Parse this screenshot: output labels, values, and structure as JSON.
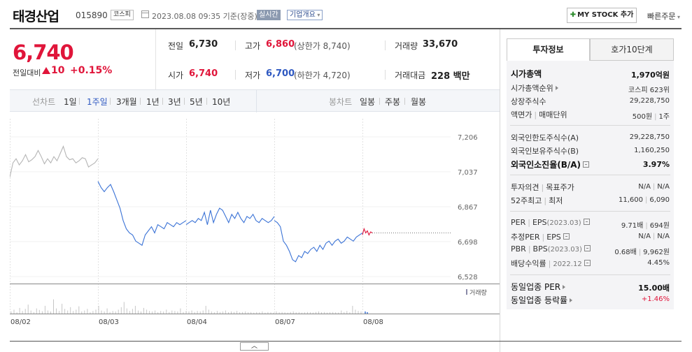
{
  "header": {
    "company_name": "태경산업",
    "stock_code": "015890",
    "market_badge": "코스피",
    "timestamp": "2023.08.08 09:35 기준(장중)",
    "realtime_badge": "실시간",
    "company_overview_label": "기업개요",
    "mystock_label": "MY STOCK 추가",
    "quick_order_label": "빠른주문"
  },
  "price": {
    "current": "6,740",
    "change_label": "전일대비",
    "change_value": "10",
    "change_pct": "+0.15%",
    "accent_color": "#e0153a"
  },
  "quote": {
    "prev_close_label": "전일",
    "prev_close": "6,730",
    "high_label": "고가",
    "high": "6,860",
    "upper_limit": "(상한가 8,740)",
    "volume_label": "거래량",
    "volume": "33,670",
    "open_label": "시가",
    "open": "6,740",
    "low_label": "저가",
    "low": "6,700",
    "lower_limit": "(하한가 4,720)",
    "amount_label": "거래대금",
    "amount": "228 백만"
  },
  "chart_toolbar": {
    "line_chart_label": "선차트",
    "line_periods": [
      "1일",
      "1주일",
      "3개월",
      "1년",
      "3년",
      "5년",
      "10년"
    ],
    "active_line_period": "1주일",
    "candle_chart_label": "봉차트",
    "candle_periods": [
      "일봉",
      "주봉",
      "월봉"
    ]
  },
  "right_panel": {
    "tabs": [
      "투자정보",
      "호가10단계"
    ],
    "market_cap_label": "시가총액",
    "market_cap": "1,970억원",
    "cap_rank_label": "시가총액순위",
    "cap_rank": "코스피 623위",
    "shares_label": "상장주식수",
    "shares": "29,228,750",
    "par_label": "액면가",
    "par_label2": "매매단위",
    "par": "500원",
    "unit": "1주",
    "foreign_limit_label": "외국인한도주식수(A)",
    "foreign_limit": "29,228,750",
    "foreign_hold_label": "외국인보유주식수(B)",
    "foreign_hold": "1,160,250",
    "foreign_ratio_label": "외국인소진율(B/A)",
    "foreign_ratio": "3.97%",
    "opinion_label": "투자의견",
    "target_label": "목표주가",
    "opinion": "N/A",
    "target": "N/A",
    "week52_label": "52주최고",
    "week52_low_label": "최저",
    "week52_high": "11,600",
    "week52_low": "6,090",
    "per_label": "PER",
    "eps_label": "EPS",
    "per_period": "(2023.03)",
    "per": "9.71배",
    "eps": "694원",
    "est_per_label": "추정PER",
    "est_eps_label": "EPS",
    "est_per": "N/A",
    "est_eps": "N/A",
    "pbr_label": "PBR",
    "bps_label": "BPS",
    "pbr_period": "(2023.03)",
    "pbr": "0.68배",
    "bps": "9,962원",
    "div_label": "배당수익률",
    "div_period": "2022.12",
    "div": "4.45%",
    "industry_per_label": "동일업종 PER",
    "industry_per": "15.00배",
    "industry_change_label": "동일업종 등락률",
    "industry_change": "+1.46%"
  },
  "chart_data": {
    "type": "line",
    "x": [
      "08/02",
      "08/03",
      "08/04",
      "08/07",
      "08/08"
    ],
    "y_ticks": [
      7206,
      7037,
      6867,
      6698,
      6528
    ],
    "ylim": [
      6528,
      7206
    ],
    "ylabel": "",
    "volume_label": "거래량",
    "series": [
      {
        "day": "08/02",
        "values": [
          7010,
          7080,
          7100,
          7070,
          7090,
          7120,
          7085,
          7095,
          7110,
          7140,
          7110,
          7075,
          7100,
          7080,
          7110,
          7090,
          7125,
          7160,
          7110,
          7095,
          7100,
          7080,
          7090,
          7105,
          7100,
          7060,
          7070,
          7080,
          7100
        ]
      },
      {
        "day": "08/03",
        "values": [
          6990,
          6960,
          6940,
          6960,
          6975,
          6940,
          6900,
          6860,
          6800,
          6760,
          6740,
          6730,
          6700,
          6690,
          6680,
          6730,
          6750,
          6770,
          6740,
          6780,
          6770,
          6760,
          6790,
          6780,
          6770,
          6790,
          6780,
          6790,
          6800
        ]
      },
      {
        "day": "08/04",
        "values": [
          6780,
          6790,
          6800,
          6790,
          6810,
          6800,
          6840,
          6780,
          6850,
          6790,
          6830,
          6860,
          6850,
          6820,
          6790,
          6830,
          6810,
          6840,
          6810,
          6790,
          6820,
          6810,
          6830,
          6800,
          6790,
          6810,
          6800,
          6790,
          6800,
          6820
        ]
      },
      {
        "day": "08/07",
        "values": [
          6800,
          6790,
          6770,
          6700,
          6680,
          6650,
          6610,
          6600,
          6630,
          6620,
          6650,
          6640,
          6660,
          6670,
          6650,
          6680,
          6660,
          6690,
          6700,
          6680,
          6700,
          6710,
          6690,
          6700,
          6720,
          6710,
          6700,
          6720,
          6730,
          6740
        ]
      },
      {
        "day": "08/08",
        "values": [
          6730,
          6760,
          6740,
          6750,
          6730,
          6745,
          6740
        ]
      }
    ],
    "current_price_line": 6740,
    "volume": [
      0.08,
      0.15,
      0.05,
      0.22,
      0.1,
      0.18,
      0.35,
      0.12,
      0.06,
      0.2,
      0.14,
      0.09,
      0.3,
      0.12,
      0.08,
      0.55,
      0.2,
      0.1,
      0.38,
      0.18,
      0.12,
      0.25,
      0.1,
      0.15,
      0.28,
      0.08,
      0.12,
      0.18,
      0.05,
      0.1,
      0.15,
      0.3,
      0.12,
      0.08,
      0.2,
      0.06,
      0.1,
      0.08,
      0.15,
      0.25,
      0.45,
      0.2,
      0.1,
      0.18,
      0.3,
      0.12,
      0.08,
      0.22,
      0.15,
      0.1,
      0.08,
      0.12,
      0.05,
      0.1,
      0.08,
      0.15,
      0.06,
      0.12,
      0.1,
      0.08,
      0.2,
      0.06,
      0.1,
      0.08,
      0.12,
      0.06,
      0.1,
      0.08,
      0.12,
      0.3,
      0.15,
      0.08,
      0.05,
      0.1,
      0.06,
      0.08,
      0.12,
      0.05,
      0.08,
      0.06,
      0.1,
      0.05,
      0.06,
      0.08,
      0.05,
      0.06,
      0.04,
      0.06,
      0.05,
      0.08,
      0.04,
      0.06,
      0.05,
      0.04,
      0.08,
      0.05,
      0.06,
      0.05,
      0.04,
      0.06,
      0.08,
      0.05,
      0.06,
      0.04,
      0.05,
      0.06,
      0.05,
      0.04,
      0.06,
      0.08,
      0.05,
      0.06,
      0.04,
      0.05,
      0.06,
      0.05,
      0.04,
      0.12,
      0.06,
      0.1,
      0.05,
      0.3,
      0.15,
      0.1,
      0.08
    ]
  }
}
